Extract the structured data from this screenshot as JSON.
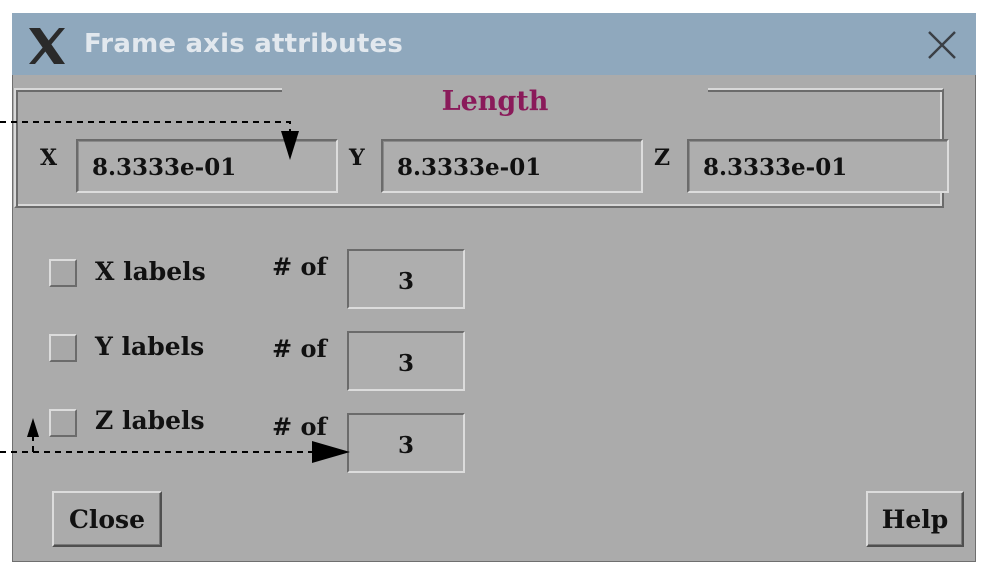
{
  "window": {
    "title": "Frame axis attributes",
    "title_bar_color": "#8fa8bd",
    "icons": {
      "app": "x-logo-icon",
      "close": "close-icon"
    }
  },
  "length_group": {
    "title": "Length",
    "title_color": "#8a1a5a",
    "x": {
      "label": "X",
      "value": "8.3333e-01"
    },
    "y": {
      "label": "Y",
      "value": "8.3333e-01"
    },
    "z": {
      "label": "Z",
      "value": "8.3333e-01"
    }
  },
  "labels": {
    "num_of_label": "# of",
    "rows": [
      {
        "label": "X labels",
        "checked": false,
        "count": "3"
      },
      {
        "label": "Y labels",
        "checked": false,
        "count": "3"
      },
      {
        "label": "Z labels",
        "checked": false,
        "count": "3"
      }
    ]
  },
  "buttons": {
    "close": "Close",
    "help": "Help"
  }
}
